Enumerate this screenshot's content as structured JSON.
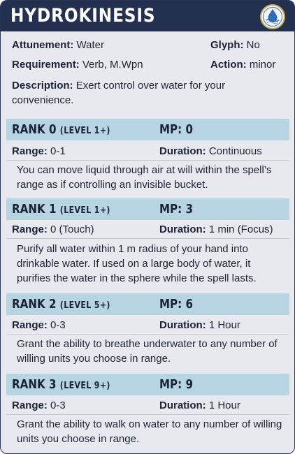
{
  "title": "HYDROKINESIS",
  "emblem_icon": "water-element-emblem",
  "info": {
    "attunement_label": "Attunement:",
    "attunement_value": "Water",
    "glyph_label": "Glyph:",
    "glyph_value": "No",
    "requirement_label": "Requirement:",
    "requirement_value": "Verb, M.Wpn",
    "action_label": "Action:",
    "action_value": "minor",
    "description_label": "Description:",
    "description_value": "Exert control over water for your convenience."
  },
  "ranks": [
    {
      "rank": "RANK 0",
      "level": "(LEVEL 1+)",
      "mp": "MP: 0",
      "range_label": "Range:",
      "range": "0-1",
      "duration_label": "Duration:",
      "duration": "Continuous",
      "text": "You can move liquid through air at will within the spell’s range as if controlling an invisible bucket."
    },
    {
      "rank": "RANK 1",
      "level": "(LEVEL 1+)",
      "mp": "MP: 3",
      "range_label": "Range:",
      "range": "0 (Touch)",
      "duration_label": "Duration:",
      "duration": "1 min (Focus)",
      "text": "Purify all water within 1 m radius of your hand into drinkable water. If used on a large body of water, it purifies the water in the sphere while the spell lasts."
    },
    {
      "rank": "RANK 2",
      "level": "(LEVEL 5+)",
      "mp": "MP: 6",
      "range_label": "Range:",
      "range": "0-3",
      "duration_label": "Duration:",
      "duration": "1 Hour",
      "text": "Grant the ability to breathe underwater to any number of willing units you choose in range."
    },
    {
      "rank": "RANK 3",
      "level": "(LEVEL 9+)",
      "mp": "MP: 9",
      "range_label": "Range:",
      "range": "0-3",
      "duration_label": "Duration:",
      "duration": "1 Hour",
      "text": "Grant the ability to walk on water to any number of willing units you choose in range."
    }
  ]
}
